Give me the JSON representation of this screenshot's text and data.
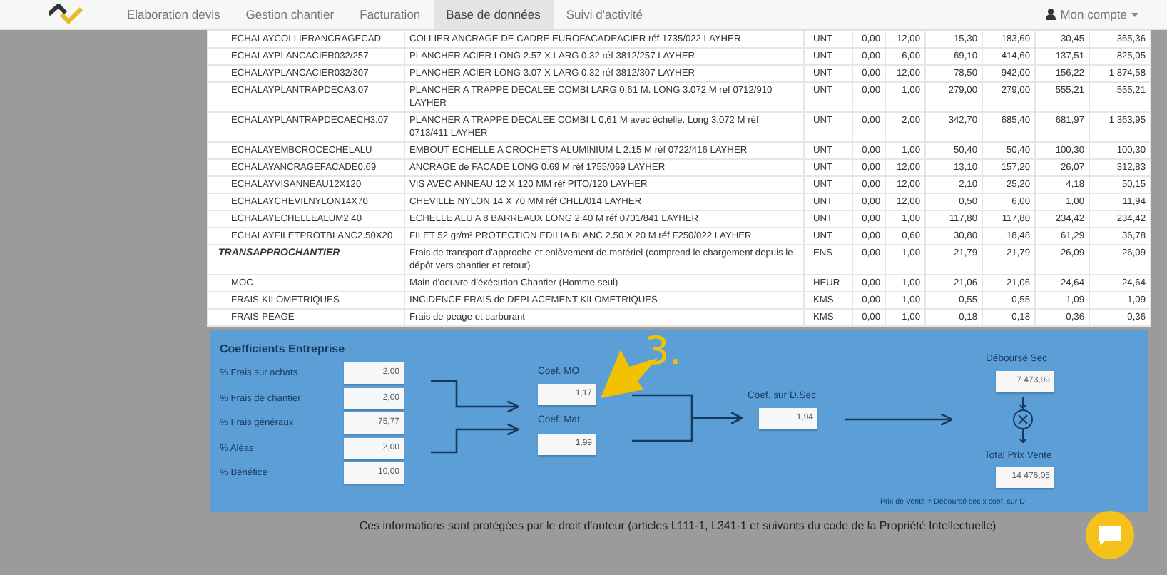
{
  "nav": {
    "tabs": [
      {
        "label": "Elaboration devis",
        "selected": false
      },
      {
        "label": "Gestion chantier",
        "selected": false
      },
      {
        "label": "Facturation",
        "selected": false
      },
      {
        "label": "Base de données",
        "selected": true
      },
      {
        "label": "Suivi d'activité",
        "selected": false
      }
    ],
    "account": "Mon compte"
  },
  "table": {
    "rows": [
      {
        "kind": "item",
        "code": "ECHALAYCOLLIERANCRAGECAD",
        "designation": "COLLIER ANCRAGE DE CADRE EUROFACADEACIER réf 1735/022 LAYHER",
        "unit": "UNT",
        "values": [
          "0,00",
          "12,00",
          "15,30",
          "183,60",
          "30,45",
          "365,36"
        ]
      },
      {
        "kind": "item",
        "code": "ECHALAYPLANCACIER032/257",
        "designation": "PLANCHER ACIER LONG 2.57 X LARG 0.32 réf 3812/257 LAYHER",
        "unit": "UNT",
        "values": [
          "0,00",
          "6,00",
          "69,10",
          "414,60",
          "137,51",
          "825,05"
        ]
      },
      {
        "kind": "item",
        "code": "ECHALAYPLANCACIER032/307",
        "designation": "PLANCHER ACIER LONG 3.07 X LARG 0.32 réf 3812/307 LAYHER",
        "unit": "UNT",
        "values": [
          "0,00",
          "12,00",
          "78,50",
          "942,00",
          "156,22",
          "1 874,58"
        ]
      },
      {
        "kind": "item",
        "code": "ECHALAYPLANTRAPDECA3.07",
        "designation": "PLANCHER A TRAPPE DECALEE COMBI LARG 0,61 M. LONG 3.072 M réf 0712/910 LAYHER",
        "unit": "UNT",
        "values": [
          "0,00",
          "1,00",
          "279,00",
          "279,00",
          "555,21",
          "555,21"
        ]
      },
      {
        "kind": "item",
        "code": "ECHALAYPLANTRAPDECAECH3.07",
        "designation": "PLANCHER A TRAPPE DECALEE COMBI L 0,61 M avec échelle. Long 3.072 M réf 0713/411 LAYHER",
        "unit": "UNT",
        "values": [
          "0,00",
          "2,00",
          "342,70",
          "685,40",
          "681,97",
          "1 363,95"
        ]
      },
      {
        "kind": "item",
        "code": "ECHALAYEMBCROCECHELALU",
        "designation": "EMBOUT ECHELLE A CROCHETS ALUMINIUM L 2.15 M réf 0722/416 LAYHER",
        "unit": "UNT",
        "values": [
          "0,00",
          "1,00",
          "50,40",
          "50,40",
          "100,30",
          "100,30"
        ]
      },
      {
        "kind": "item",
        "code": "ECHALAYANCRAGEFACADE0.69",
        "designation": "ANCRAGE de FACADE LONG 0.69 M réf 1755/069 LAYHER",
        "unit": "UNT",
        "values": [
          "0,00",
          "12,00",
          "13,10",
          "157,20",
          "26,07",
          "312,83"
        ]
      },
      {
        "kind": "item",
        "code": "ECHALAYVISANNEAU12X120",
        "designation": "VIS AVEC ANNEAU 12 X 120 MM réf PITO/120 LAYHER",
        "unit": "UNT",
        "values": [
          "0,00",
          "12,00",
          "2,10",
          "25,20",
          "4,18",
          "50,15"
        ]
      },
      {
        "kind": "item",
        "code": "ECHALAYCHEVILNYLON14X70",
        "designation": "CHEVILLE NYLON 14 X 70 MM réf CHLL/014 LAYHER",
        "unit": "UNT",
        "values": [
          "0,00",
          "12,00",
          "0,50",
          "6,00",
          "1,00",
          "11,94"
        ]
      },
      {
        "kind": "item",
        "code": "ECHALAYECHELLEALUM2.40",
        "designation": "ECHELLE ALU A 8 BARREAUX LONG 2.40 M réf 0701/841 LAYHER",
        "unit": "UNT",
        "values": [
          "0,00",
          "1,00",
          "117,80",
          "117,80",
          "234,42",
          "234,42"
        ]
      },
      {
        "kind": "item",
        "code": "ECHALAYFILETPROTBLANC2.50X20",
        "designation": "FILET 52 gr/m² PROTECTION EDILIA BLANC 2.50 X 20 M réf F250/022 LAYHER",
        "unit": "UNT",
        "values": [
          "0,00",
          "0,60",
          "30,80",
          "18,48",
          "61,29",
          "36,78"
        ]
      },
      {
        "kind": "group",
        "code": "TRANSAPPROCHANTIER",
        "designation": "Frais de transport d'approche et enlèvement de matériel (comprend le chargement depuis le dépôt vers chantier et retour)",
        "unit": "ENS",
        "values": [
          "0,00",
          "1,00",
          "21,79",
          "21,79",
          "26,09",
          "26,09"
        ]
      },
      {
        "kind": "item",
        "code": "MOC",
        "designation": "Main d'oeuvre d'éxécution Chantier (Homme seul)",
        "unit": "HEUR",
        "values": [
          "0,00",
          "1,00",
          "21,06",
          "21,06",
          "24,64",
          "24,64"
        ]
      },
      {
        "kind": "item",
        "code": "FRAIS-KILOMETRIQUES",
        "designation": "INCIDENCE FRAIS de DEPLACEMENT KILOMETRIQUES",
        "unit": "KMS",
        "values": [
          "0,00",
          "1,00",
          "0,55",
          "0,55",
          "1,09",
          "1,09"
        ]
      },
      {
        "kind": "item",
        "code": "FRAIS-PEAGE",
        "designation": "Frais de peage et carburant",
        "unit": "KMS",
        "values": [
          "0,00",
          "1,00",
          "0,18",
          "0,18",
          "0,36",
          "0,36"
        ]
      }
    ]
  },
  "coefficients": {
    "title": "Coefficients Entreprise",
    "inputs": [
      {
        "label": "% Frais sur achats",
        "value": "2,00"
      },
      {
        "label": "% Frais de chantier",
        "value": "2,00"
      },
      {
        "label": "% Frais généraux",
        "value": "75,77"
      },
      {
        "label": "% Aléas",
        "value": "2,00"
      },
      {
        "label": "% Bénéfice",
        "value": "10,00"
      }
    ],
    "coef_mo": {
      "label": "Coef. MO",
      "value": "1,17"
    },
    "coef_mat": {
      "label": "Coef. Mat",
      "value": "1,99"
    },
    "coef_dsec": {
      "label": "Coef. sur D.Sec",
      "value": "1,94"
    },
    "debourse_sec": {
      "label": "Déboursé Sec",
      "value": "7 473,99"
    },
    "total": {
      "label": "Total Prix Vente",
      "value": "14 476,05"
    },
    "formula": "Prix de Vente = Déboursé sec x coef. sur D",
    "annotation": "3."
  },
  "footer": "Ces informations sont protégées par le droit d'auteur (articles L111-1, L341-1 et suivants du code de la Propriété Intellectuelle)"
}
